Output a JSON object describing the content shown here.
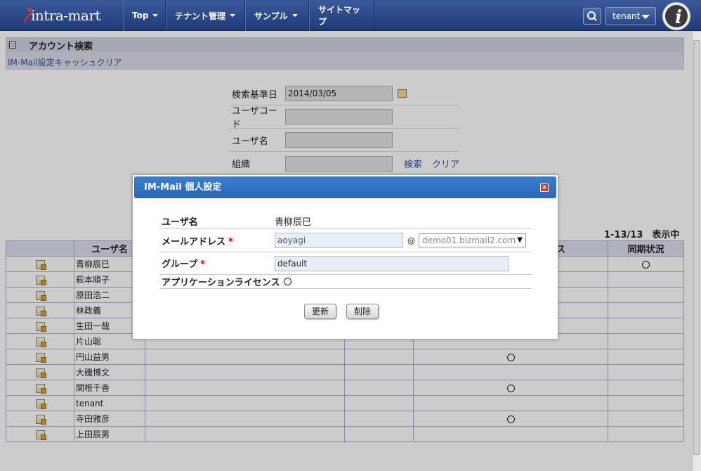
{
  "logo_text": "intra-mart",
  "nav": {
    "items": [
      "Top",
      "テナント管理",
      "サンプル",
      "サイトマップ"
    ],
    "user": "tenant"
  },
  "header": {
    "title": "アカウント検索",
    "link": "IM-Mail設定キャッシュクリア"
  },
  "search": {
    "date_label": "検索基準日",
    "date_value": "2014/03/05",
    "user_code_label": "ユーザコード",
    "user_name_label": "ユーザ名",
    "org_label": "組織",
    "search_link": "検索",
    "clear_link": "クリア"
  },
  "result_count": "1-13/13　表示中",
  "table": {
    "columns": [
      "",
      "ユーザ名",
      "",
      "",
      "ス",
      "同期状況"
    ],
    "rows": [
      {
        "name": "青柳辰巳",
        "license": "",
        "sync": "○"
      },
      {
        "name": "萩本順子",
        "license": "",
        "sync": ""
      },
      {
        "name": "原田浩二",
        "license": "",
        "sync": ""
      },
      {
        "name": "林政義",
        "license": "",
        "sync": ""
      },
      {
        "name": "生田一哉",
        "license": "○",
        "sync": ""
      },
      {
        "name": "片山聡",
        "license": "",
        "sync": ""
      },
      {
        "name": "円山益男",
        "license": "○",
        "sync": ""
      },
      {
        "name": "大磯博文",
        "license": "",
        "sync": ""
      },
      {
        "name": "関根千香",
        "license": "○",
        "sync": ""
      },
      {
        "name": "tenant",
        "license": "",
        "sync": ""
      },
      {
        "name": "寺田雅彦",
        "license": "○",
        "sync": ""
      },
      {
        "name": "上田辰男",
        "license": "",
        "sync": ""
      }
    ]
  },
  "dialog": {
    "title": "IM-Mail 個人設定",
    "close_label": "x",
    "user_name_label": "ユーザ名",
    "user_name_value": "青柳辰巳",
    "mail_label": "メールアドレス",
    "mail_local": "aoyagi",
    "at": "@",
    "mail_domain": "demo01.bizmail2.com",
    "group_label": "グループ",
    "group_value": "default",
    "app_license_label": "アプリケーションライセンス",
    "required_mark": "*",
    "update_button": "更新",
    "delete_button": "削除"
  }
}
